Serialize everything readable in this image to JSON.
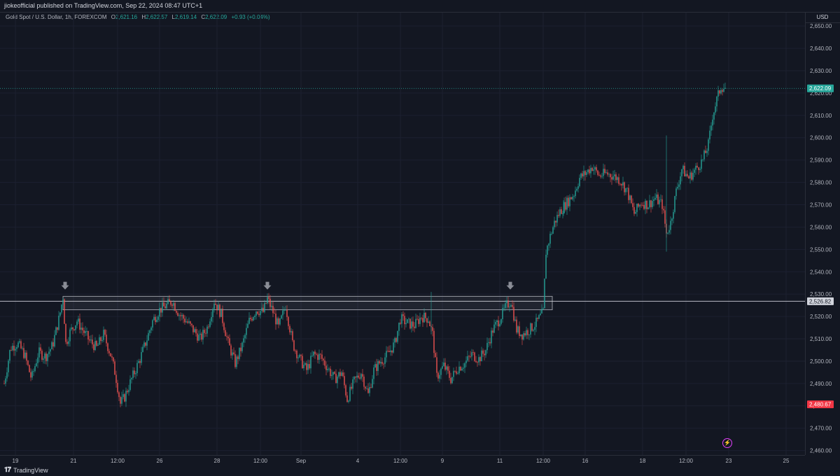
{
  "header": {
    "text": "jiokeofficial published on TradingView.com, Sep 22, 2024 08:47 UTC+1"
  },
  "symbol": {
    "name": "Gold Spot / U.S. Dollar, 1h, FOREXCOM",
    "open_label": "O",
    "open": "2,621.16",
    "high_label": "H",
    "high": "2,622.57",
    "low_label": "L",
    "low": "2,619.14",
    "close_label": "C",
    "close": "2,622.09",
    "change": "+0.93 (+0.04%)"
  },
  "price_axis": {
    "currency": "USD",
    "ticks": [
      "2,650.00",
      "2,640.00",
      "2,630.00",
      "2,620.00",
      "2,610.00",
      "2,600.00",
      "2,590.00",
      "2,580.00",
      "2,570.00",
      "2,560.00",
      "2,550.00",
      "2,540.00",
      "2,530.00",
      "2,520.00",
      "2,510.00",
      "2,500.00",
      "2,490.00",
      "2,480.00",
      "2,470.00",
      "2,460.00"
    ],
    "tick_values": [
      2650,
      2640,
      2630,
      2620,
      2610,
      2600,
      2590,
      2580,
      2570,
      2560,
      2550,
      2540,
      2530,
      2520,
      2510,
      2500,
      2490,
      2480,
      2470,
      2460
    ],
    "labels": [
      {
        "text": "2,622.09",
        "value": 2622.09,
        "color": "#26a69a"
      },
      {
        "text": "2,526.82",
        "value": 2526.82,
        "color": "#d1d4dc"
      },
      {
        "text": "2,480.67",
        "value": 2480.67,
        "color": "#f23645"
      }
    ]
  },
  "time_axis": {
    "labels": [
      "19",
      "21",
      "12:00",
      "26",
      "28",
      "12:00",
      "Sep",
      "4",
      "12:00",
      "9",
      "11",
      "12:00",
      "16",
      "18",
      "12:00",
      "23",
      "25"
    ]
  },
  "chart_data": {
    "type": "candlestick",
    "symbol": "XAUUSD",
    "interval": "1h",
    "ylim": [
      2458,
      2656
    ],
    "resistance_zone": [
      2523,
      2529
    ],
    "horizontal_line": 2526.82,
    "current_price_line": 2622.09,
    "markers": [
      "down-arrow",
      "down-arrow",
      "down-arrow"
    ],
    "price_path": [
      [
        0,
        2470
      ],
      [
        6,
        2490
      ],
      [
        15,
        2506
      ],
      [
        25,
        2508
      ],
      [
        35,
        2503
      ],
      [
        45,
        2492
      ],
      [
        55,
        2504
      ],
      [
        65,
        2502
      ],
      [
        75,
        2507
      ],
      [
        85,
        2520
      ],
      [
        90,
        2529
      ],
      [
        94,
        2508
      ],
      [
        100,
        2513
      ],
      [
        110,
        2518
      ],
      [
        118,
        2514
      ],
      [
        128,
        2509
      ],
      [
        138,
        2506
      ],
      [
        148,
        2512
      ],
      [
        158,
        2503
      ],
      [
        165,
        2494
      ],
      [
        172,
        2481
      ],
      [
        178,
        2484
      ],
      [
        188,
        2492
      ],
      [
        200,
        2501
      ],
      [
        210,
        2510
      ],
      [
        218,
        2518
      ],
      [
        228,
        2523
      ],
      [
        238,
        2525
      ],
      [
        246,
        2527
      ],
      [
        256,
        2521
      ],
      [
        266,
        2518
      ],
      [
        276,
        2514
      ],
      [
        286,
        2510
      ],
      [
        296,
        2515
      ],
      [
        306,
        2527
      ],
      [
        316,
        2521
      ],
      [
        326,
        2508
      ],
      [
        336,
        2499
      ],
      [
        346,
        2507
      ],
      [
        356,
        2518
      ],
      [
        366,
        2523
      ],
      [
        376,
        2522
      ],
      [
        382,
        2528
      ],
      [
        390,
        2522
      ],
      [
        398,
        2515
      ],
      [
        408,
        2525
      ],
      [
        418,
        2508
      ],
      [
        428,
        2501
      ],
      [
        438,
        2496
      ],
      [
        448,
        2503
      ],
      [
        458,
        2502
      ],
      [
        468,
        2497
      ],
      [
        478,
        2492
      ],
      [
        488,
        2495
      ],
      [
        496,
        2483
      ],
      [
        506,
        2491
      ],
      [
        516,
        2495
      ],
      [
        526,
        2485
      ],
      [
        534,
        2496
      ],
      [
        544,
        2500
      ],
      [
        554,
        2503
      ],
      [
        564,
        2508
      ],
      [
        572,
        2519
      ],
      [
        582,
        2517
      ],
      [
        592,
        2516
      ],
      [
        602,
        2520
      ],
      [
        612,
        2519
      ],
      [
        618,
        2512
      ],
      [
        624,
        2493
      ],
      [
        634,
        2498
      ],
      [
        644,
        2492
      ],
      [
        654,
        2497
      ],
      [
        664,
        2499
      ],
      [
        674,
        2503
      ],
      [
        684,
        2501
      ],
      [
        694,
        2505
      ],
      [
        704,
        2514
      ],
      [
        714,
        2519
      ],
      [
        724,
        2525
      ],
      [
        730,
        2527
      ],
      [
        738,
        2514
      ],
      [
        746,
        2512
      ],
      [
        756,
        2514
      ],
      [
        766,
        2517
      ],
      [
        776,
        2522
      ],
      [
        780,
        2549
      ],
      [
        786,
        2556
      ],
      [
        792,
        2562
      ],
      [
        800,
        2567
      ],
      [
        810,
        2571
      ],
      [
        820,
        2575
      ],
      [
        828,
        2582
      ],
      [
        836,
        2584
      ],
      [
        846,
        2587
      ],
      [
        856,
        2583
      ],
      [
        866,
        2584
      ],
      [
        876,
        2583
      ],
      [
        886,
        2581
      ],
      [
        896,
        2576
      ],
      [
        906,
        2566
      ],
      [
        916,
        2571
      ],
      [
        926,
        2570
      ],
      [
        936,
        2573
      ],
      [
        946,
        2570
      ],
      [
        952,
        2557
      ],
      [
        958,
        2562
      ],
      [
        966,
        2576
      ],
      [
        974,
        2586
      ],
      [
        984,
        2582
      ],
      [
        994,
        2586
      ],
      [
        1004,
        2590
      ],
      [
        1012,
        2597
      ],
      [
        1018,
        2610
      ],
      [
        1024,
        2617
      ],
      [
        1030,
        2623
      ],
      [
        1037,
        2622
      ]
    ]
  }
}
